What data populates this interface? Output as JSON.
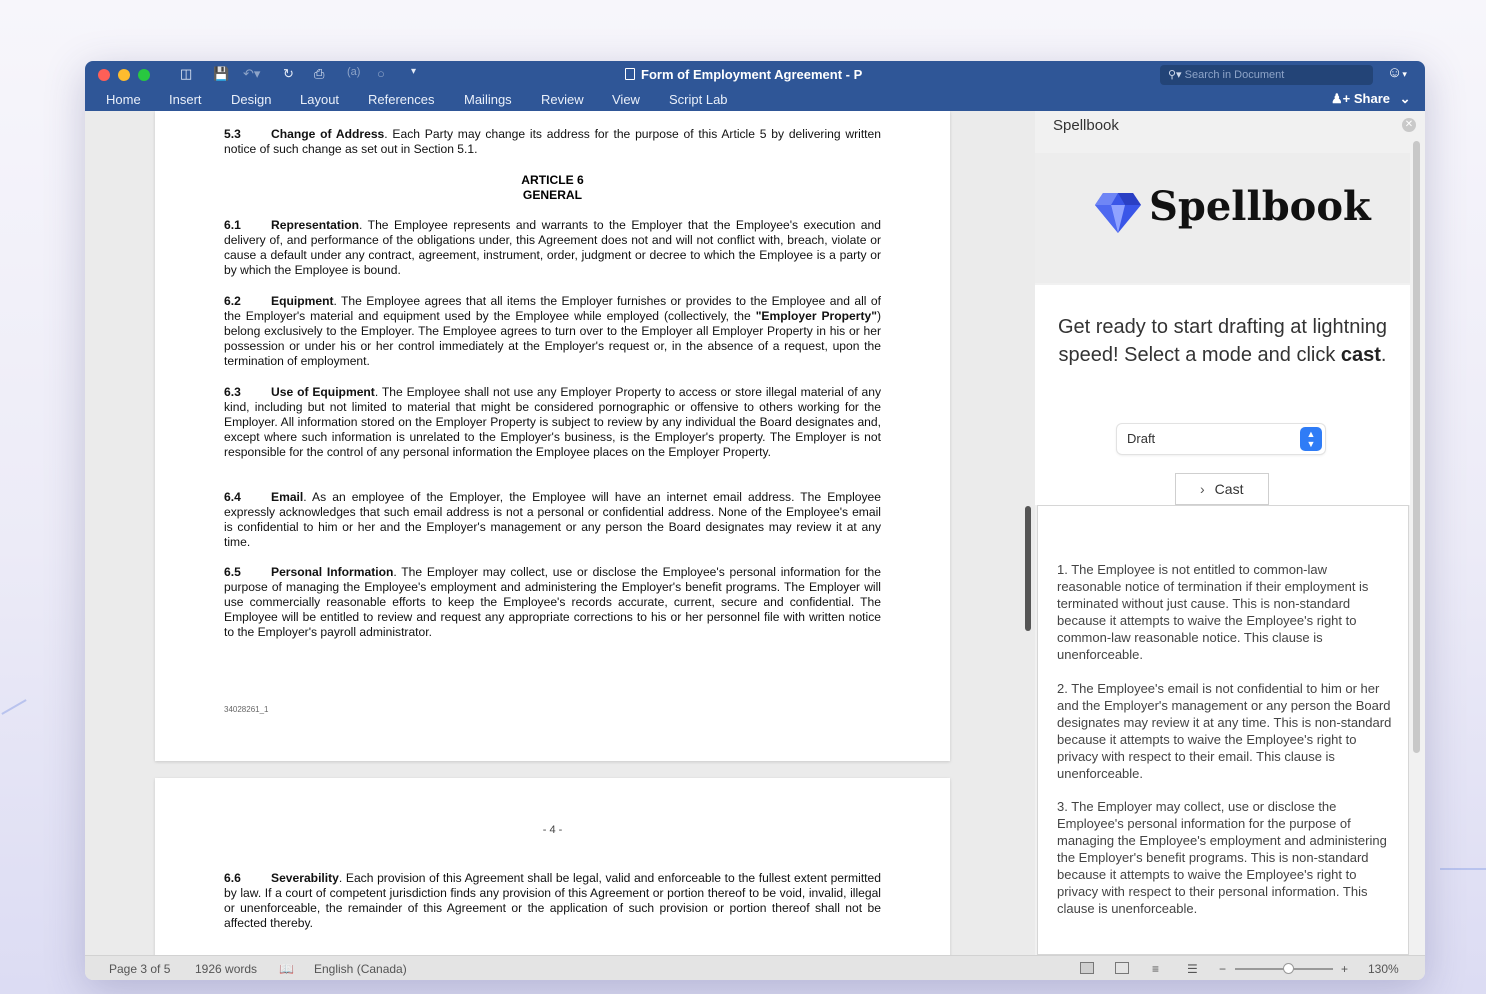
{
  "window": {
    "title": "Form of Employment Agreement - P",
    "search_placeholder": "Search in Document",
    "quick_access": [
      "sidebar-icon",
      "save-icon",
      "undo-icon",
      "redo-icon",
      "print-icon",
      "format-icon",
      "circle-icon",
      "more-icon"
    ]
  },
  "ribbon": {
    "tabs": [
      "Home",
      "Insert",
      "Design",
      "Layout",
      "References",
      "Mailings",
      "Review",
      "View",
      "Script Lab"
    ],
    "share_label": "Share"
  },
  "document": {
    "s53": {
      "num": "5.3",
      "heading": "Change of Address",
      "text": ". Each Party may change its address for the purpose of this Article 5 by delivering written notice of such change as set out in Section 5.1."
    },
    "article_line1": "ARTICLE 6",
    "article_line2": "GENERAL",
    "s61": {
      "num": "6.1",
      "heading": "Representation",
      "text": ". The Employee represents and warrants to the Employer that the Employee's execution and delivery of, and performance of the obligations under, this Agreement does not and will not conflict with, breach, violate or cause a default under any contract, agreement, instrument, order, judgment or decree to which the Employee is a party or by which the Employee is bound."
    },
    "s62": {
      "num": "6.2",
      "heading": "Equipment",
      "text_a": ". The Employee agrees that all items the Employer furnishes or provides to the Employee and all of the Employer's material and equipment used by the Employee while employed (collectively, the ",
      "bold": "\"Employer Property\"",
      "text_b": ") belong exclusively to the Employer. The Employee agrees to turn over to the Employer all Employer Property in his or her possession or under his or her control immediately at the Employer's request or, in the absence of a request, upon the termination of employment."
    },
    "s63": {
      "num": "6.3",
      "heading": "Use of Equipment",
      "text": ". The Employee shall not use any Employer Property to access or store illegal material of any kind, including but not limited to material that might be considered pornographic or offensive to others working for the Employer. All information stored on the Employer Property is subject to review by any individual the Board designates and, except where such information is unrelated to the Employer's business, is the Employer's property. The Employer is not responsible for the control of any personal information the Employee places on the Employer Property."
    },
    "s64": {
      "num": "6.4",
      "heading": "Email",
      "text": ". As an employee of the Employer, the Employee will have an internet email address. The Employee expressly acknowledges that such email address is not a personal or confidential address. None of the Employee's email is confidential to him or her and the Employer's management or any person the Board designates may review it at any time."
    },
    "s65": {
      "num": "6.5",
      "heading": "Personal Information",
      "text": ". The Employer may collect, use or disclose the Employee's personal information for the purpose of managing the Employee's employment and administering the Employer's benefit programs. The Employer will use commercially reasonable efforts to keep the Employee's records accurate, current, secure and confidential. The Employee will be entitled to review and request any appropriate corrections to his or her personnel file with written notice to the Employer's payroll administrator."
    },
    "doc_id": "34028261_1",
    "page_number": "- 4 -",
    "s66": {
      "num": "6.6",
      "heading": "Severability",
      "text": ". Each provision of this Agreement shall be legal, valid and enforceable to the fullest extent permitted by law. If a court of competent jurisdiction finds any provision of this Agreement or portion thereof to be void, invalid, illegal or unenforceable, the remainder of this Agreement or the application of such provision or portion thereof shall not be affected thereby."
    }
  },
  "pane": {
    "title": "Spellbook",
    "brand_name": "Spellbook",
    "intro_a": "Get ready to start drafting at lightning speed! Select a mode and click ",
    "intro_bold": "cast",
    "intro_b": ".",
    "mode_value": "Draft",
    "cast_label": "Cast",
    "results": [
      "1. The Employee is not entitled to common-law reasonable notice of termination if their employment is terminated without just cause. This is non-standard because it attempts to waive the Employee's right to common-law reasonable notice. This clause is unenforceable.",
      "2. The Employee's email is not confidential to him or her and the Employer's management or any person the Board designates may review it at any time. This is non-standard because it attempts to waive the Employee's right to privacy with respect to their email. This clause is unenforceable.",
      "3. The Employer may collect, use or disclose the Employee's personal information for the purpose of managing the Employee's employment and administering the Employer's benefit programs. This is non-standard because it attempts to waive the Employee's right to privacy with respect to their personal information. This clause is unenforceable."
    ]
  },
  "status": {
    "page": "Page 3 of 5",
    "words": "1926 words",
    "language": "English (Canada)",
    "zoom": "130%"
  },
  "colors": {
    "titlebar": "#2f5697",
    "accent": "#2f7cf6"
  }
}
